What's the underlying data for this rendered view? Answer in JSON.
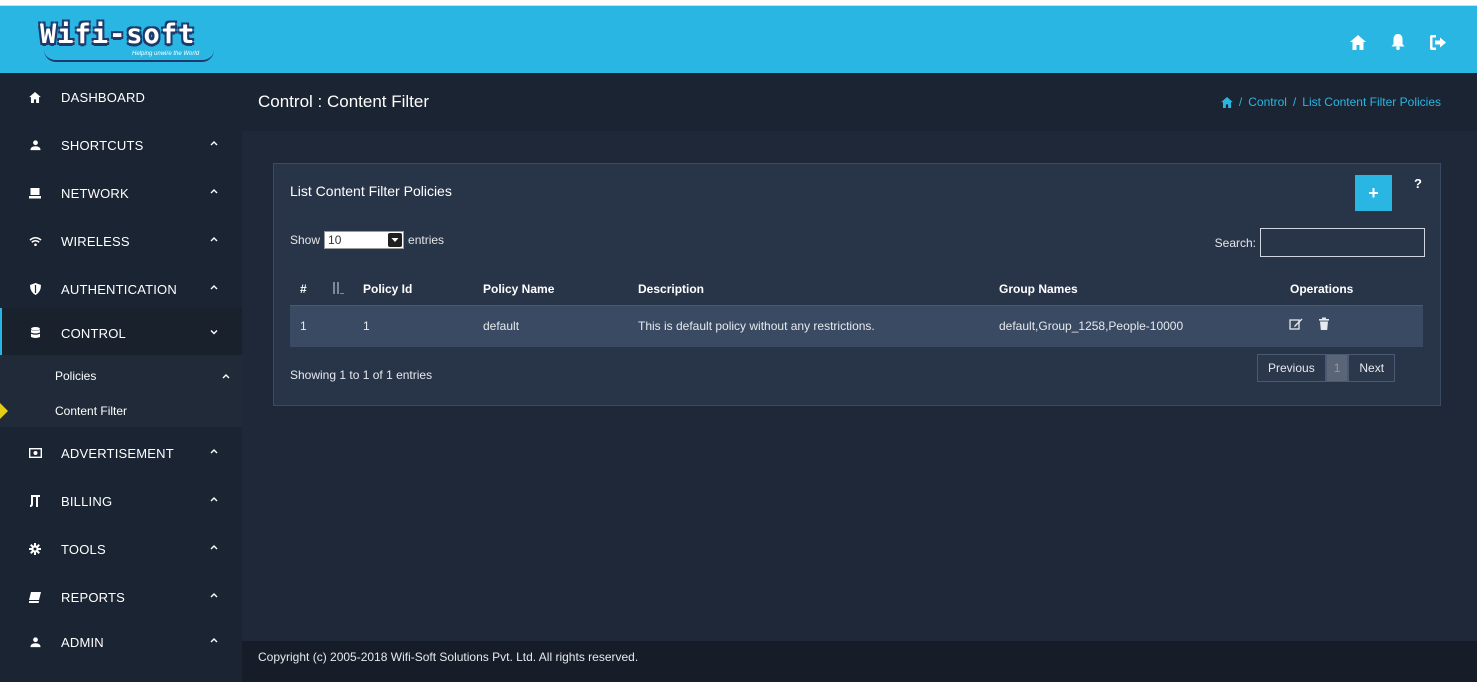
{
  "brand": {
    "name": "Wifi-soft",
    "tagline": "Helping unwire the World"
  },
  "header": {
    "icons": [
      "home-icon",
      "bell-icon",
      "sign-out-icon"
    ]
  },
  "sidebar": {
    "items": [
      {
        "label": "DASHBOARD",
        "icon": "home-icon"
      },
      {
        "label": "SHORTCUTS",
        "icon": "user-icon"
      },
      {
        "label": "NETWORK",
        "icon": "desktop-icon"
      },
      {
        "label": "WIRELESS",
        "icon": "wifi-icon"
      },
      {
        "label": "AUTHENTICATION",
        "icon": "shield-icon"
      },
      {
        "label": "CONTROL",
        "icon": "database-icon"
      },
      {
        "label": "ADVERTISEMENT",
        "icon": "camera-icon"
      },
      {
        "label": "BILLING",
        "icon": "billing-icon"
      },
      {
        "label": "TOOLS",
        "icon": "gear-icon"
      },
      {
        "label": "REPORTS",
        "icon": "book-icon"
      },
      {
        "label": "ADMIN",
        "icon": "user-icon"
      }
    ],
    "control_sub": [
      {
        "label": "Policies"
      },
      {
        "label": "Content Filter"
      }
    ]
  },
  "page": {
    "title": "Control : Content Filter",
    "breadcrumb": [
      "Control",
      "List Content Filter Policies"
    ]
  },
  "panel": {
    "title": "List Content Filter Policies",
    "add_label": "+",
    "help_label": "?",
    "show_label": "Show",
    "entries_label": "entries",
    "page_size": "10",
    "search_label": "Search:",
    "search_value": "",
    "columns": [
      "#",
      "Policy Id",
      "Policy Name",
      "Description",
      "Group Names",
      "Operations"
    ],
    "rows": [
      {
        "num": "1",
        "policy_id": "1",
        "policy_name": "default",
        "description": "This is default policy without any restrictions.",
        "group_names": "default,Group_1258,People-10000"
      }
    ],
    "info": "Showing 1 to 1 of 1 entries",
    "pagination": {
      "previous": "Previous",
      "current": "1",
      "next": "Next"
    }
  },
  "footer": {
    "text": "Copyright (c) 2005-2018 Wifi-Soft Solutions Pvt. Ltd. All rights reserved."
  },
  "colors": {
    "accent": "#29b6e3",
    "sidebar": "#1b2432",
    "content": "#1f2839",
    "panel": "#283549",
    "row": "#3a4a63"
  }
}
